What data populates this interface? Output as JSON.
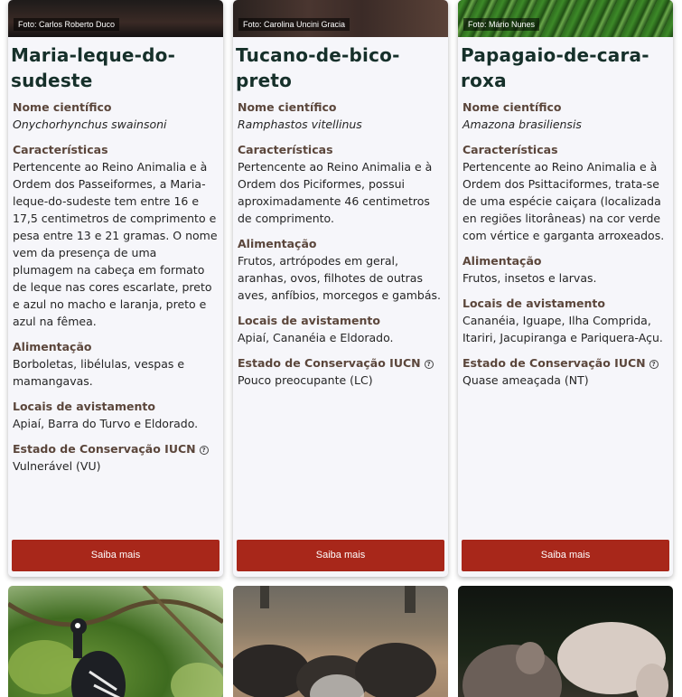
{
  "cards": [
    {
      "photo_credit": "Foto: Carlos Roberto Duco",
      "title": "Maria-leque-do-sudeste",
      "sci_label": "Nome científico",
      "sci_name": "Onychorhynchus swainsoni",
      "char_label": "Características",
      "char_text": "Pertencente ao Reino Animalia e à Ordem dos Passeiformes, a Maria-leque-do-sudeste tem entre 16 e 17,5 centimetros de comprimento e pesa entre 13 e 21 gramas. O nome vem da presença de uma plumagem na cabeça em formato de leque nas cores escarlate, preto e azul no macho e laranja, preto e azul na fêmea.",
      "food_label": "Alimentação",
      "food_text": "Borboletas, libélulas, vespas e mamangavas.",
      "places_label": "Locais de avistamento",
      "places_text": "Apiaí, Barra do Turvo e Eldorado.",
      "status_label": "Estado de Conservação IUCN",
      "status_text": "Vulnerável (VU)",
      "button": "Saiba mais"
    },
    {
      "photo_credit": "Foto: Carolina Uncini Gracia",
      "title": "Tucano-de-bico-preto",
      "sci_label": "Nome científico",
      "sci_name": "Ramphastos vitellinus",
      "char_label": "Características",
      "char_text": "Pertencente ao Reino Animalia e à Ordem dos Piciformes, possui aproximadamente 46 centimetros de comprimento.",
      "food_label": "Alimentação",
      "food_text": "Frutos, artrópodes em geral, aranhas, ovos, filhotes de outras aves, anfíbios, morcegos e gambás.",
      "places_label": "Locais de avistamento",
      "places_text": "Apiaí, Cananéia e Eldorado.",
      "status_label": "Estado de Conservação IUCN",
      "status_text": "Pouco preocupante (LC)",
      "button": "Saiba mais"
    },
    {
      "photo_credit": "Foto: Mário Nunes",
      "title": "Papagaio-de-cara-roxa",
      "sci_label": "Nome científico",
      "sci_name": "Amazona brasiliensis",
      "char_label": "Características",
      "char_text": "Pertencente ao Reino Animalia e à Ordem dos Psittaciformes, trata-se de uma espécie caiçara (localizada en regiões litorâneas) na cor verde com vértice e garganta arroxeados.",
      "food_label": "Alimentação",
      "food_text": "Frutos, insetos e larvas.",
      "places_label": "Locais de avistamento",
      "places_text": "Cananéia, Iguape, Ilha Comprida, Itariri, Jacupiranga e Pariquera-Açu.",
      "status_label": "Estado de Conservação IUCN",
      "status_text": "Quase ameaçada (NT)",
      "button": "Saiba mais"
    }
  ],
  "help_icon_glyph": "?",
  "colors": {
    "button": "#a8271a",
    "title": "#16302a",
    "label": "#5b463b"
  }
}
